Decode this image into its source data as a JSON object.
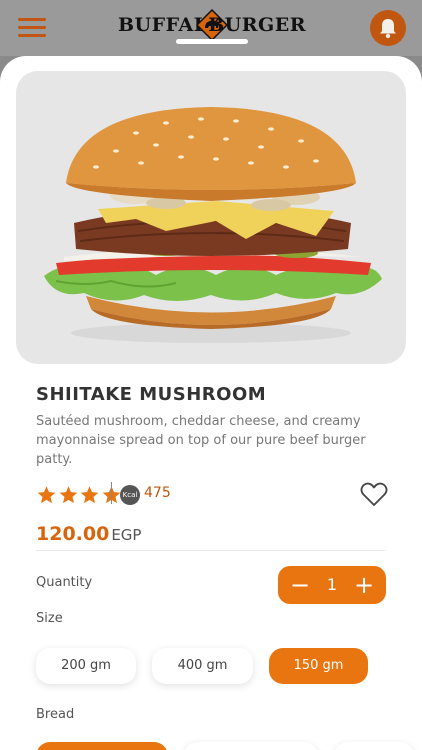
{
  "header": {
    "brand_left": "BUFFALO",
    "brand_right": "BURGER",
    "menu_icon": "hamburger-menu-icon",
    "bell_icon": "bell-icon"
  },
  "colors": {
    "accent": "#e8750f",
    "accent_dark": "#c0560f",
    "title": "#333333",
    "muted": "#777777"
  },
  "product": {
    "name": "SHIITAKE MUSHROOM",
    "description": "Sautéed mushroom, cheddar cheese, and creamy mayonnaise spread on top of our pure beef burger patty.",
    "rating": 4,
    "rating_max": 5,
    "kcal_badge": "Kcal",
    "kcal": "475",
    "price": "120.00",
    "currency": "EGP"
  },
  "quantity": {
    "label": "Quantity",
    "value": "1",
    "minus": "−",
    "plus": "+"
  },
  "size": {
    "label": "Size",
    "options": [
      "200 gm",
      "400 gm",
      "150 gm"
    ],
    "selected": "150 gm"
  },
  "bread": {
    "label": "Bread"
  }
}
